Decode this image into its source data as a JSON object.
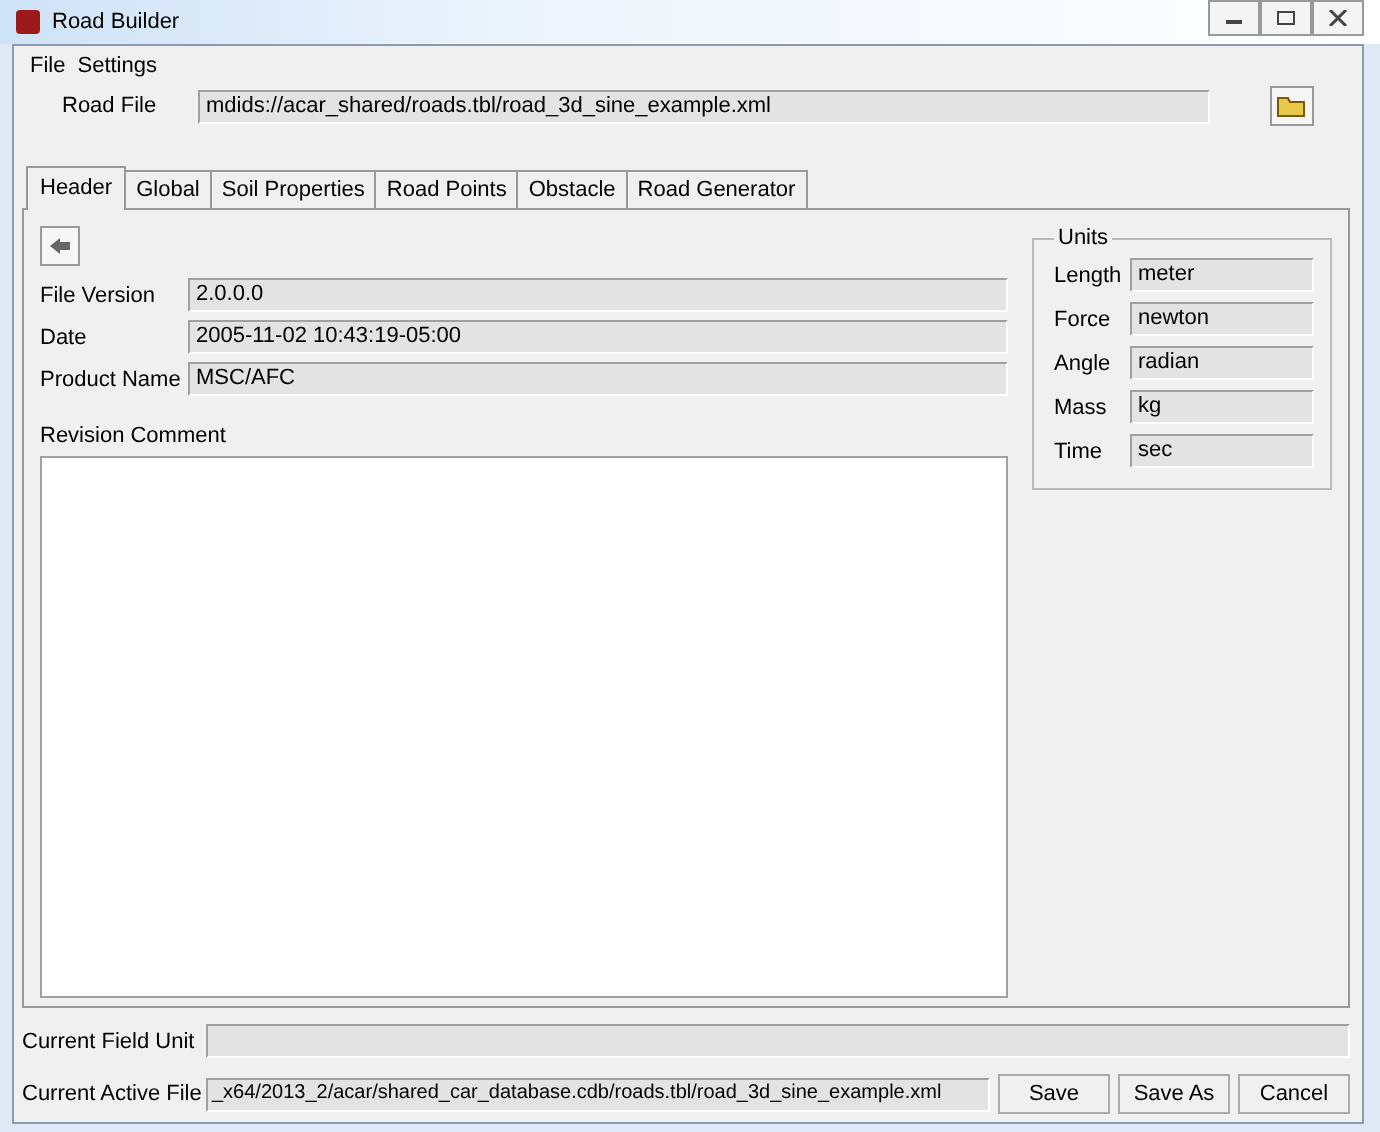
{
  "window": {
    "title": "Road Builder"
  },
  "menu": [
    {
      "label": "File"
    },
    {
      "label": "Settings"
    }
  ],
  "road_file": {
    "label": "Road File",
    "value": "mdids://acar_shared/roads.tbl/road_3d_sine_example.xml"
  },
  "tabs": [
    {
      "label": "Header",
      "selected": true
    },
    {
      "label": "Global",
      "selected": false
    },
    {
      "label": "Soil Properties",
      "selected": false
    },
    {
      "label": "Road Points",
      "selected": false
    },
    {
      "label": "Obstacle",
      "selected": false
    },
    {
      "label": "Road Generator",
      "selected": false
    }
  ],
  "header_fields": [
    {
      "label": "File Version",
      "value": "2.0.0.0"
    },
    {
      "label": "Date",
      "value": "2005-11-02 10:43:19-05:00"
    },
    {
      "label": "Product Name",
      "value": "MSC/AFC"
    }
  ],
  "revision_comment": {
    "label": "Revision Comment"
  },
  "units": {
    "title": "Units",
    "fields": [
      {
        "label": "Length",
        "value": "meter"
      },
      {
        "label": "Force",
        "value": "newton"
      },
      {
        "label": "Angle",
        "value": "radian"
      },
      {
        "label": "Mass",
        "value": "kg"
      },
      {
        "label": "Time",
        "value": "sec"
      }
    ]
  },
  "current_field_unit": {
    "label": "Current Field Unit"
  },
  "current_active_file": {
    "label": "Current Active File",
    "value": "_x64/2013_2/acar/shared_car_database.cdb/roads.tbl/road_3d_sine_example.xml"
  },
  "buttons": [
    {
      "label": "Save"
    },
    {
      "label": "Save As"
    },
    {
      "label": "Cancel"
    }
  ]
}
